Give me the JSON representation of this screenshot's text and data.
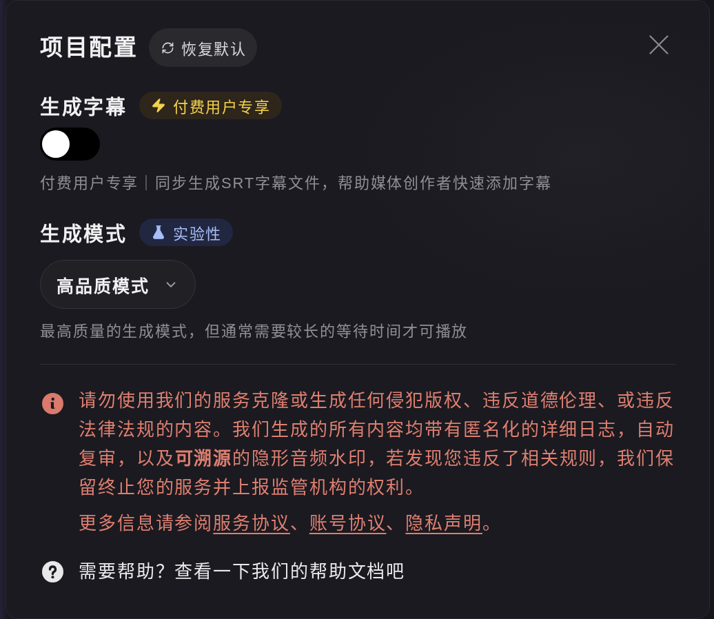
{
  "dialog": {
    "title": "项目配置",
    "reset_button": "恢复默认"
  },
  "sections": [
    {
      "kind": "toggle",
      "heading": "生成字幕",
      "badge": {
        "kind": "premium",
        "label": "付费用户专享"
      },
      "on": false,
      "description": "付费用户专享｜同步生成SRT字幕文件，帮助媒体创作者快速添加字幕"
    },
    {
      "kind": "select",
      "heading": "生成模式",
      "badge": {
        "kind": "experimental",
        "label": "实验性"
      },
      "value": "高品质模式",
      "description": "最高质量的生成模式，但通常需要较长的等待时间才可播放"
    }
  ],
  "notice": {
    "text": "请勿使用我们的服务克隆或生成任何侵犯版权、违反道德伦理、或违反法律法规的内容。我们生成的所有内容均带有匿名化的详细日志，自动复审，以及**可溯源**的隐形音频水印，若发现您违反了相关规则，我们保留终止您的服务并上报监管机构的权利。",
    "more_info": [
      {
        "kind": "text",
        "text": "更多信息请参阅"
      },
      {
        "kind": "link",
        "text": "服务协议"
      },
      {
        "kind": "text",
        "text": "、"
      },
      {
        "kind": "link",
        "text": "账号协议"
      },
      {
        "kind": "text",
        "text": "、"
      },
      {
        "kind": "link",
        "text": "隐私声明"
      },
      {
        "kind": "text",
        "text": "。"
      }
    ]
  },
  "help": {
    "text": "需要帮助？查看一下我们的帮助文档吧"
  }
}
